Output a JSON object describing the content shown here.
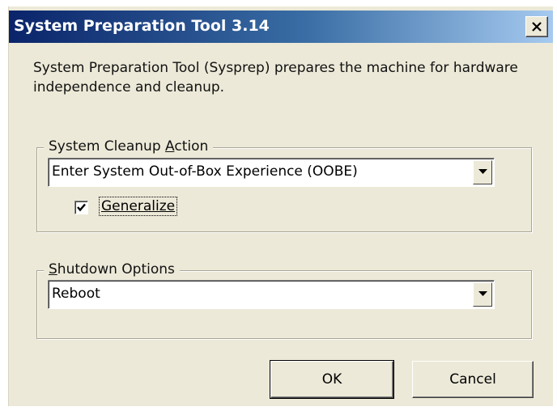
{
  "window": {
    "title": "System Preparation Tool 3.14",
    "description": "System Preparation Tool (Sysprep) prepares the machine for hardware independence and cleanup."
  },
  "cleanup_group": {
    "label_before": "System Cleanup ",
    "label_access": "A",
    "label_after": "ction",
    "selected_action": "Enter System Out-of-Box Experience (OOBE)",
    "generalize_label": "Generalize",
    "generalize_checked": true
  },
  "shutdown_group": {
    "label_access": "S",
    "label_after": "hutdown Options",
    "selected_option": "Reboot"
  },
  "buttons": {
    "ok": "OK",
    "cancel": "Cancel"
  },
  "icons": {
    "close": "close-icon",
    "dropdown": "chevron-down-icon",
    "check": "check-icon"
  }
}
